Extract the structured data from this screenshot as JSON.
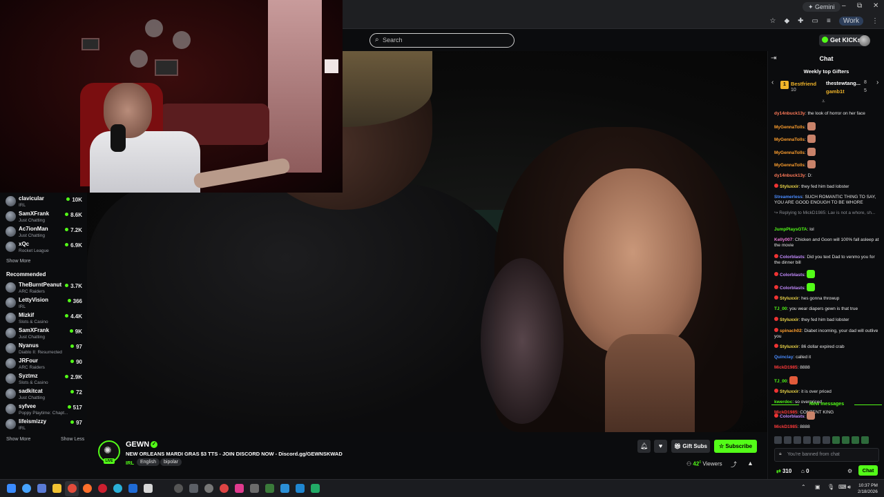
{
  "browser": {
    "gemini_label": "Gemini",
    "profile_label": "Work",
    "window_controls": [
      "–",
      "⧉",
      "✕"
    ]
  },
  "header": {
    "search_placeholder": "Search",
    "get_kicks_label": "Get KICKs"
  },
  "sidebar": {
    "following": [
      {
        "name": "clavicular",
        "category": "IRL",
        "viewers": "10K"
      },
      {
        "name": "SamXFrank",
        "category": "Just Chatting",
        "viewers": "8.6K"
      },
      {
        "name": "Ac7ionMan",
        "category": "Just Chatting",
        "viewers": "7.2K"
      },
      {
        "name": "xQc",
        "category": "Rocket League",
        "viewers": "6.9K"
      }
    ],
    "show_more_label": "Show More",
    "recommended_heading": "Recommended",
    "recommended": [
      {
        "name": "TheBurntPeanut",
        "category": "ARC Raiders",
        "viewers": "3.7K"
      },
      {
        "name": "LettyVision",
        "category": "IRL",
        "viewers": "366"
      },
      {
        "name": "Mizkif",
        "category": "Slots & Casino",
        "viewers": "4.4K"
      },
      {
        "name": "SamXFrank",
        "category": "Just Chatting",
        "viewers": "9K"
      },
      {
        "name": "Nyanus",
        "category": "Diablo II: Resurrected",
        "viewers": "97"
      },
      {
        "name": "JRFour",
        "category": "ARC Raiders",
        "viewers": "90"
      },
      {
        "name": "Syztmz",
        "category": "Slots & Casino",
        "viewers": "2.9K"
      },
      {
        "name": "sadkitcat",
        "category": "Just Chatting",
        "viewers": "72"
      },
      {
        "name": "syfvee",
        "category": "Poppy Playtime: Chapt...",
        "viewers": "517"
      },
      {
        "name": "lifeismizzy",
        "category": "IRL",
        "viewers": "97"
      }
    ],
    "show_more_bottom": "Show More",
    "show_less": "Show Less"
  },
  "stream": {
    "channel": "GEWN",
    "live_badge": "LIVE",
    "title": "NEW ORLEANS MARDI GRAS $3 TTS - JOIN DISCORD NOW - Discord.gg/GEWNSKWAD",
    "category": "IRL",
    "tags": [
      "English",
      "bipolar"
    ],
    "gift_subs_label": "Gift Subs",
    "subscribe_label": "Subscribe",
    "viewer_count": "42",
    "viewer_suffix": "0",
    "viewers_label": "Viewers"
  },
  "chat": {
    "title": "Chat",
    "gifters_title": "Weekly top Gifters",
    "gifters": [
      {
        "rank": "1",
        "name": "Bestfriend",
        "count": "10",
        "color": "#f0b429"
      },
      {
        "name": "thestewtang...",
        "count": "8",
        "color": "#ffffff"
      },
      {
        "name": "gamb1t",
        "count": "5",
        "color": "#f0b429"
      }
    ],
    "messages": [
      {
        "user": "dy14nbuck13y",
        "color": "#ff7a59",
        "text": "the look of horror on her face"
      },
      {
        "user": "MyGennaTolls",
        "color": "#ff9f2e",
        "text": "",
        "emote": "#c9836a"
      },
      {
        "user": "MyGennaTolls",
        "color": "#ff9f2e",
        "text": "",
        "emote": "#c9836a"
      },
      {
        "user": "MyGennaTolls",
        "color": "#ff9f2e",
        "text": "",
        "emote": "#c9836a"
      },
      {
        "user": "MyGennaTolls",
        "color": "#ff9f2e",
        "text": "",
        "emote": "#c9836a"
      },
      {
        "user": "dy14nbuck13y",
        "color": "#ff7a59",
        "text": "D:"
      },
      {
        "user": "Styluxxir",
        "color": "#f0d84a",
        "text": "they fed him bad lobster",
        "badge": true
      },
      {
        "user": "Streamerless",
        "color": "#4a8cff",
        "text": "SUCH ROMANTIC THING TO SAY, YOU ARE GOOD ENOUGH TO BE WHORE"
      },
      {
        "user": "",
        "color": "#8a8d93",
        "text": "↪ Replying to MickD1985: Lav is not a whore, sh..."
      },
      {
        "user": "JumpPlaysGTA",
        "color": "#53fc18",
        "text": "lol"
      },
      {
        "user": "Kelly007",
        "color": "#e87ad6",
        "text": "Chicken and Goon will 100% fall asleep at the movie"
      },
      {
        "user": "Colorblasts",
        "color": "#c48bff",
        "text": "Did you text Dad to venmo you for the dinner bill",
        "badge": true
      },
      {
        "user": "Colorblasts",
        "color": "#c48bff",
        "text": "",
        "emote": "#53fc18",
        "badge": true
      },
      {
        "user": "Colorblasts",
        "color": "#c48bff",
        "text": "",
        "emote": "#53fc18",
        "badge": true
      },
      {
        "user": "Styluxxir",
        "color": "#f0d84a",
        "text": "hes gonna throwup",
        "badge": true
      },
      {
        "user": "TJ_00",
        "color": "#53fc18",
        "text": "you wear diapers gewn is that true"
      },
      {
        "user": "Styluxxir",
        "color": "#f0d84a",
        "text": "they fed him bad lobster",
        "badge": true
      },
      {
        "user": "spinach02",
        "color": "#ff9f2e",
        "text": "Diabet incoming, your dad will outlive you",
        "badge": true
      },
      {
        "user": "Styluxxir",
        "color": "#f0d84a",
        "text": "86 dollar expired crab",
        "badge": true
      },
      {
        "user": "Quinclay",
        "color": "#4a8cff",
        "text": "called it"
      },
      {
        "user": "MickD1985",
        "color": "#ff3b3b",
        "text": "8888"
      },
      {
        "user": "TJ_00",
        "color": "#53fc18",
        "text": "",
        "emote": "#e25b3a"
      },
      {
        "user": "Styluxxir",
        "color": "#f0d84a",
        "text": "it is over priced",
        "badge": true
      },
      {
        "user": "kwerdoc",
        "color": "#53fc18",
        "text": "so overpriced"
      },
      {
        "user": "MickD1985",
        "color": "#ff3b3b",
        "text": "CONTENT KING"
      }
    ],
    "new_messages_label": "New messages",
    "after_new": [
      {
        "user": "Colorblasts",
        "color": "#c48bff",
        "text": "",
        "emote": "#c9836a",
        "badge": true
      },
      {
        "user": "MickD1985",
        "color": "#ff3b3b",
        "text": "8888"
      }
    ],
    "banned_text": "You're banned from chat",
    "points": "310",
    "store_count": "0",
    "chat_button": "Chat"
  },
  "taskbar": {
    "time": "10:37 PM",
    "date": "2/18/2026"
  }
}
